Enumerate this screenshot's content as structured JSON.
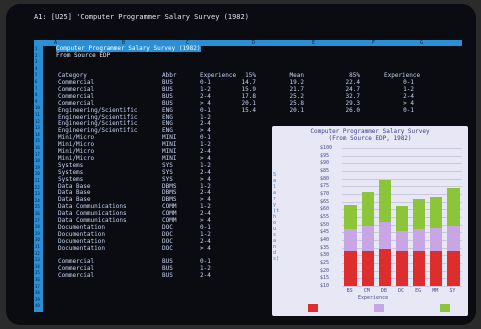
{
  "status_line": "A1: [U25] 'Computer Programmer Salary Survey (1982)",
  "column_letters": [
    "A",
    "B",
    "C",
    "D",
    "E",
    "F",
    "G"
  ],
  "row_numbers": [
    "1",
    "2",
    "3",
    "4",
    "5",
    "6",
    "7",
    "8",
    "9",
    "10",
    "11",
    "12",
    "13",
    "14",
    "15",
    "16",
    "17",
    "18",
    "19",
    "20",
    "21",
    "22",
    "23",
    "24",
    "25",
    "26",
    "27",
    "28",
    "29",
    "30",
    "31",
    "32",
    "33",
    "34",
    "35",
    "36",
    "37",
    "38",
    "39",
    "40"
  ],
  "sheet": {
    "title": "Computer Programmer Salary Survey (1982)",
    "subtitle": "From Source EDP",
    "headers": [
      "Category",
      "Abbr",
      "Experience",
      "15%",
      "Mean",
      "85%",
      "Experience"
    ],
    "rows": [
      [
        "Commercial",
        "BUS",
        "0-1",
        "14.7",
        "19.2",
        "22.4",
        "0-1"
      ],
      [
        "Commercial",
        "BUS",
        "1-2",
        "15.9",
        "21.7",
        "24.7",
        "1-2"
      ],
      [
        "Commercial",
        "BUS",
        "2-4",
        "17.8",
        "25.2",
        "32.7",
        "2-4"
      ],
      [
        "Commercial",
        "BUS",
        "> 4",
        "20.1",
        "25.8",
        "29.3",
        "> 4"
      ],
      [
        "Engineering/Scientific",
        "ENG",
        "0-1",
        "15.4",
        "20.1",
        "26.0",
        "0-1"
      ],
      [
        "Engineering/Scientific",
        "ENG",
        "1-2",
        "",
        "",
        "",
        ""
      ],
      [
        "Engineering/Scientific",
        "ENG",
        "2-4",
        "",
        "",
        "",
        ""
      ],
      [
        "Engineering/Scientific",
        "ENG",
        "> 4",
        "",
        "",
        "",
        ""
      ],
      [
        "Mini/Micro",
        "MINI",
        "0-1",
        "",
        "",
        "",
        ""
      ],
      [
        "Mini/Micro",
        "MINI",
        "1-2",
        "",
        "",
        "",
        ""
      ],
      [
        "Mini/Micro",
        "MINI",
        "2-4",
        "",
        "",
        "",
        ""
      ],
      [
        "Mini/Micro",
        "MINI",
        "> 4",
        "",
        "",
        "",
        ""
      ],
      [
        "Systems",
        "SYS",
        "1-2",
        "",
        "",
        "",
        ""
      ],
      [
        "Systems",
        "SYS",
        "2-4",
        "",
        "",
        "",
        ""
      ],
      [
        "Systems",
        "SYS",
        "> 4",
        "",
        "",
        "",
        ""
      ],
      [
        "Data Base",
        "DBMS",
        "1-2",
        "",
        "",
        "",
        ""
      ],
      [
        "Data Base",
        "DBMS",
        "2-4",
        "",
        "",
        "",
        ""
      ],
      [
        "Data Base",
        "DBMS",
        "> 4",
        "",
        "",
        "",
        ""
      ],
      [
        "Data Communications",
        "COMM",
        "1-2",
        "",
        "",
        "",
        ""
      ],
      [
        "Data Communications",
        "COMM",
        "2-4",
        "",
        "",
        "",
        ""
      ],
      [
        "Data Communications",
        "COMM",
        "> 4",
        "",
        "",
        "",
        ""
      ],
      [
        "Documentation",
        "DOC",
        "0-1",
        "",
        "",
        "",
        ""
      ],
      [
        "Documentation",
        "DOC",
        "1-2",
        "",
        "",
        "",
        ""
      ],
      [
        "Documentation",
        "DOC",
        "2-4",
        "",
        "",
        "",
        ""
      ],
      [
        "Documentation",
        "DOC",
        "> 4",
        "",
        "",
        "",
        ""
      ],
      [
        "",
        "",
        "",
        "",
        "",
        "",
        ""
      ],
      [
        "Commercial",
        "BUS",
        "0-1",
        "",
        "",
        "",
        ""
      ],
      [
        "Commercial",
        "BUS",
        "1-2",
        "",
        "",
        "",
        ""
      ],
      [
        "Commercial",
        "BUS",
        "2-4",
        "",
        "",
        "",
        ""
      ]
    ]
  },
  "chart_data": {
    "type": "bar",
    "stacked": true,
    "title": "Computer Programmer Salary Survey",
    "subtitle": "(From Source EDP, 1982)",
    "ylabel": "Salary (thousands)",
    "xlabel": "",
    "categories": [
      "BS",
      "CM",
      "DB",
      "DC",
      "EG",
      "MM",
      "SY"
    ],
    "y_ticks": [
      "$100",
      "$95",
      "$90",
      "$85",
      "$80",
      "$75",
      "$70",
      "$65",
      "$60",
      "$55",
      "$50",
      "$45",
      "$40",
      "$35",
      "$30",
      "$25",
      "$20",
      "$15",
      "$10"
    ],
    "ylim": [
      10,
      100
    ],
    "grid": true,
    "legend_title": "Experience",
    "series": [
      {
        "name": "",
        "color": "#dd2d2d",
        "values": [
          23,
          23,
          24,
          23,
          23,
          23,
          23
        ]
      },
      {
        "name": "",
        "color": "#c8a6e6",
        "values": [
          14,
          16,
          18,
          13,
          14,
          15,
          16
        ]
      },
      {
        "name": "",
        "color": "#8cc43a",
        "values": [
          16,
          22,
          27,
          16,
          20,
          20,
          25
        ]
      }
    ]
  }
}
